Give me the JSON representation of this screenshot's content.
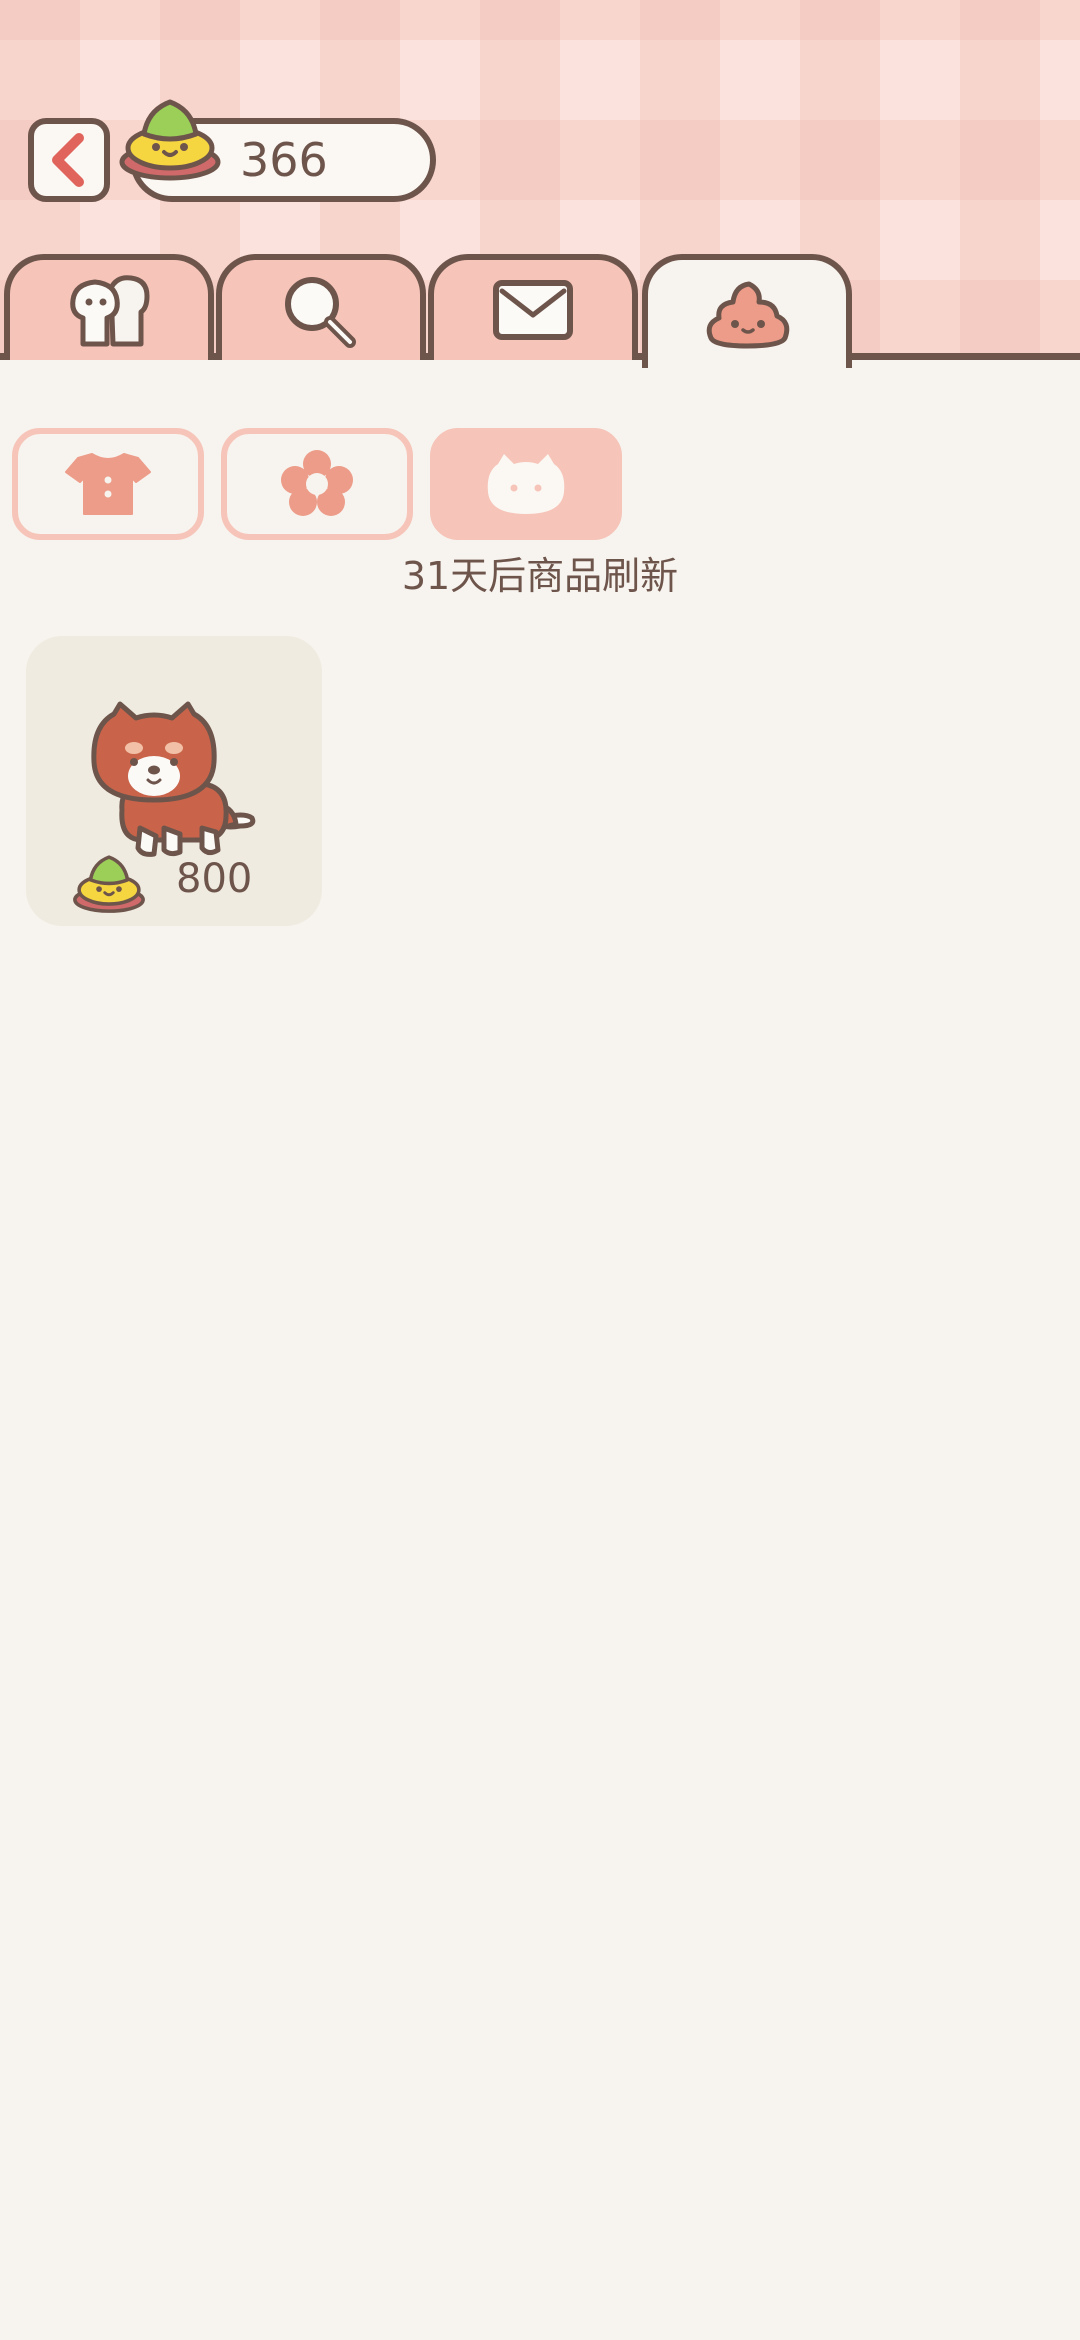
{
  "header": {
    "back_icon": "chevron-left-icon",
    "currency": {
      "icon": "poop-coin-icon",
      "value": "366"
    }
  },
  "main_tabs": [
    {
      "icon": "people-icon",
      "active": false
    },
    {
      "icon": "magnifier-icon",
      "active": false
    },
    {
      "icon": "envelope-icon",
      "active": false
    },
    {
      "icon": "poop-face-icon",
      "active": true
    }
  ],
  "sub_tabs": [
    {
      "icon": "shirt-icon",
      "active": false
    },
    {
      "icon": "flower-icon",
      "active": false
    },
    {
      "icon": "cat-face-icon",
      "active": true
    }
  ],
  "refresh_notice": "31天后商品刷新",
  "items": [
    {
      "icon": "dog-pet-icon",
      "price_icon": "poop-coin-icon",
      "price": "800"
    }
  ],
  "colors": {
    "background": "#f7f3ee",
    "outline": "#6e554c",
    "tab_fill": "#f6c4b8",
    "accent_red": "#e0645c",
    "item_card": "#efebe0"
  }
}
